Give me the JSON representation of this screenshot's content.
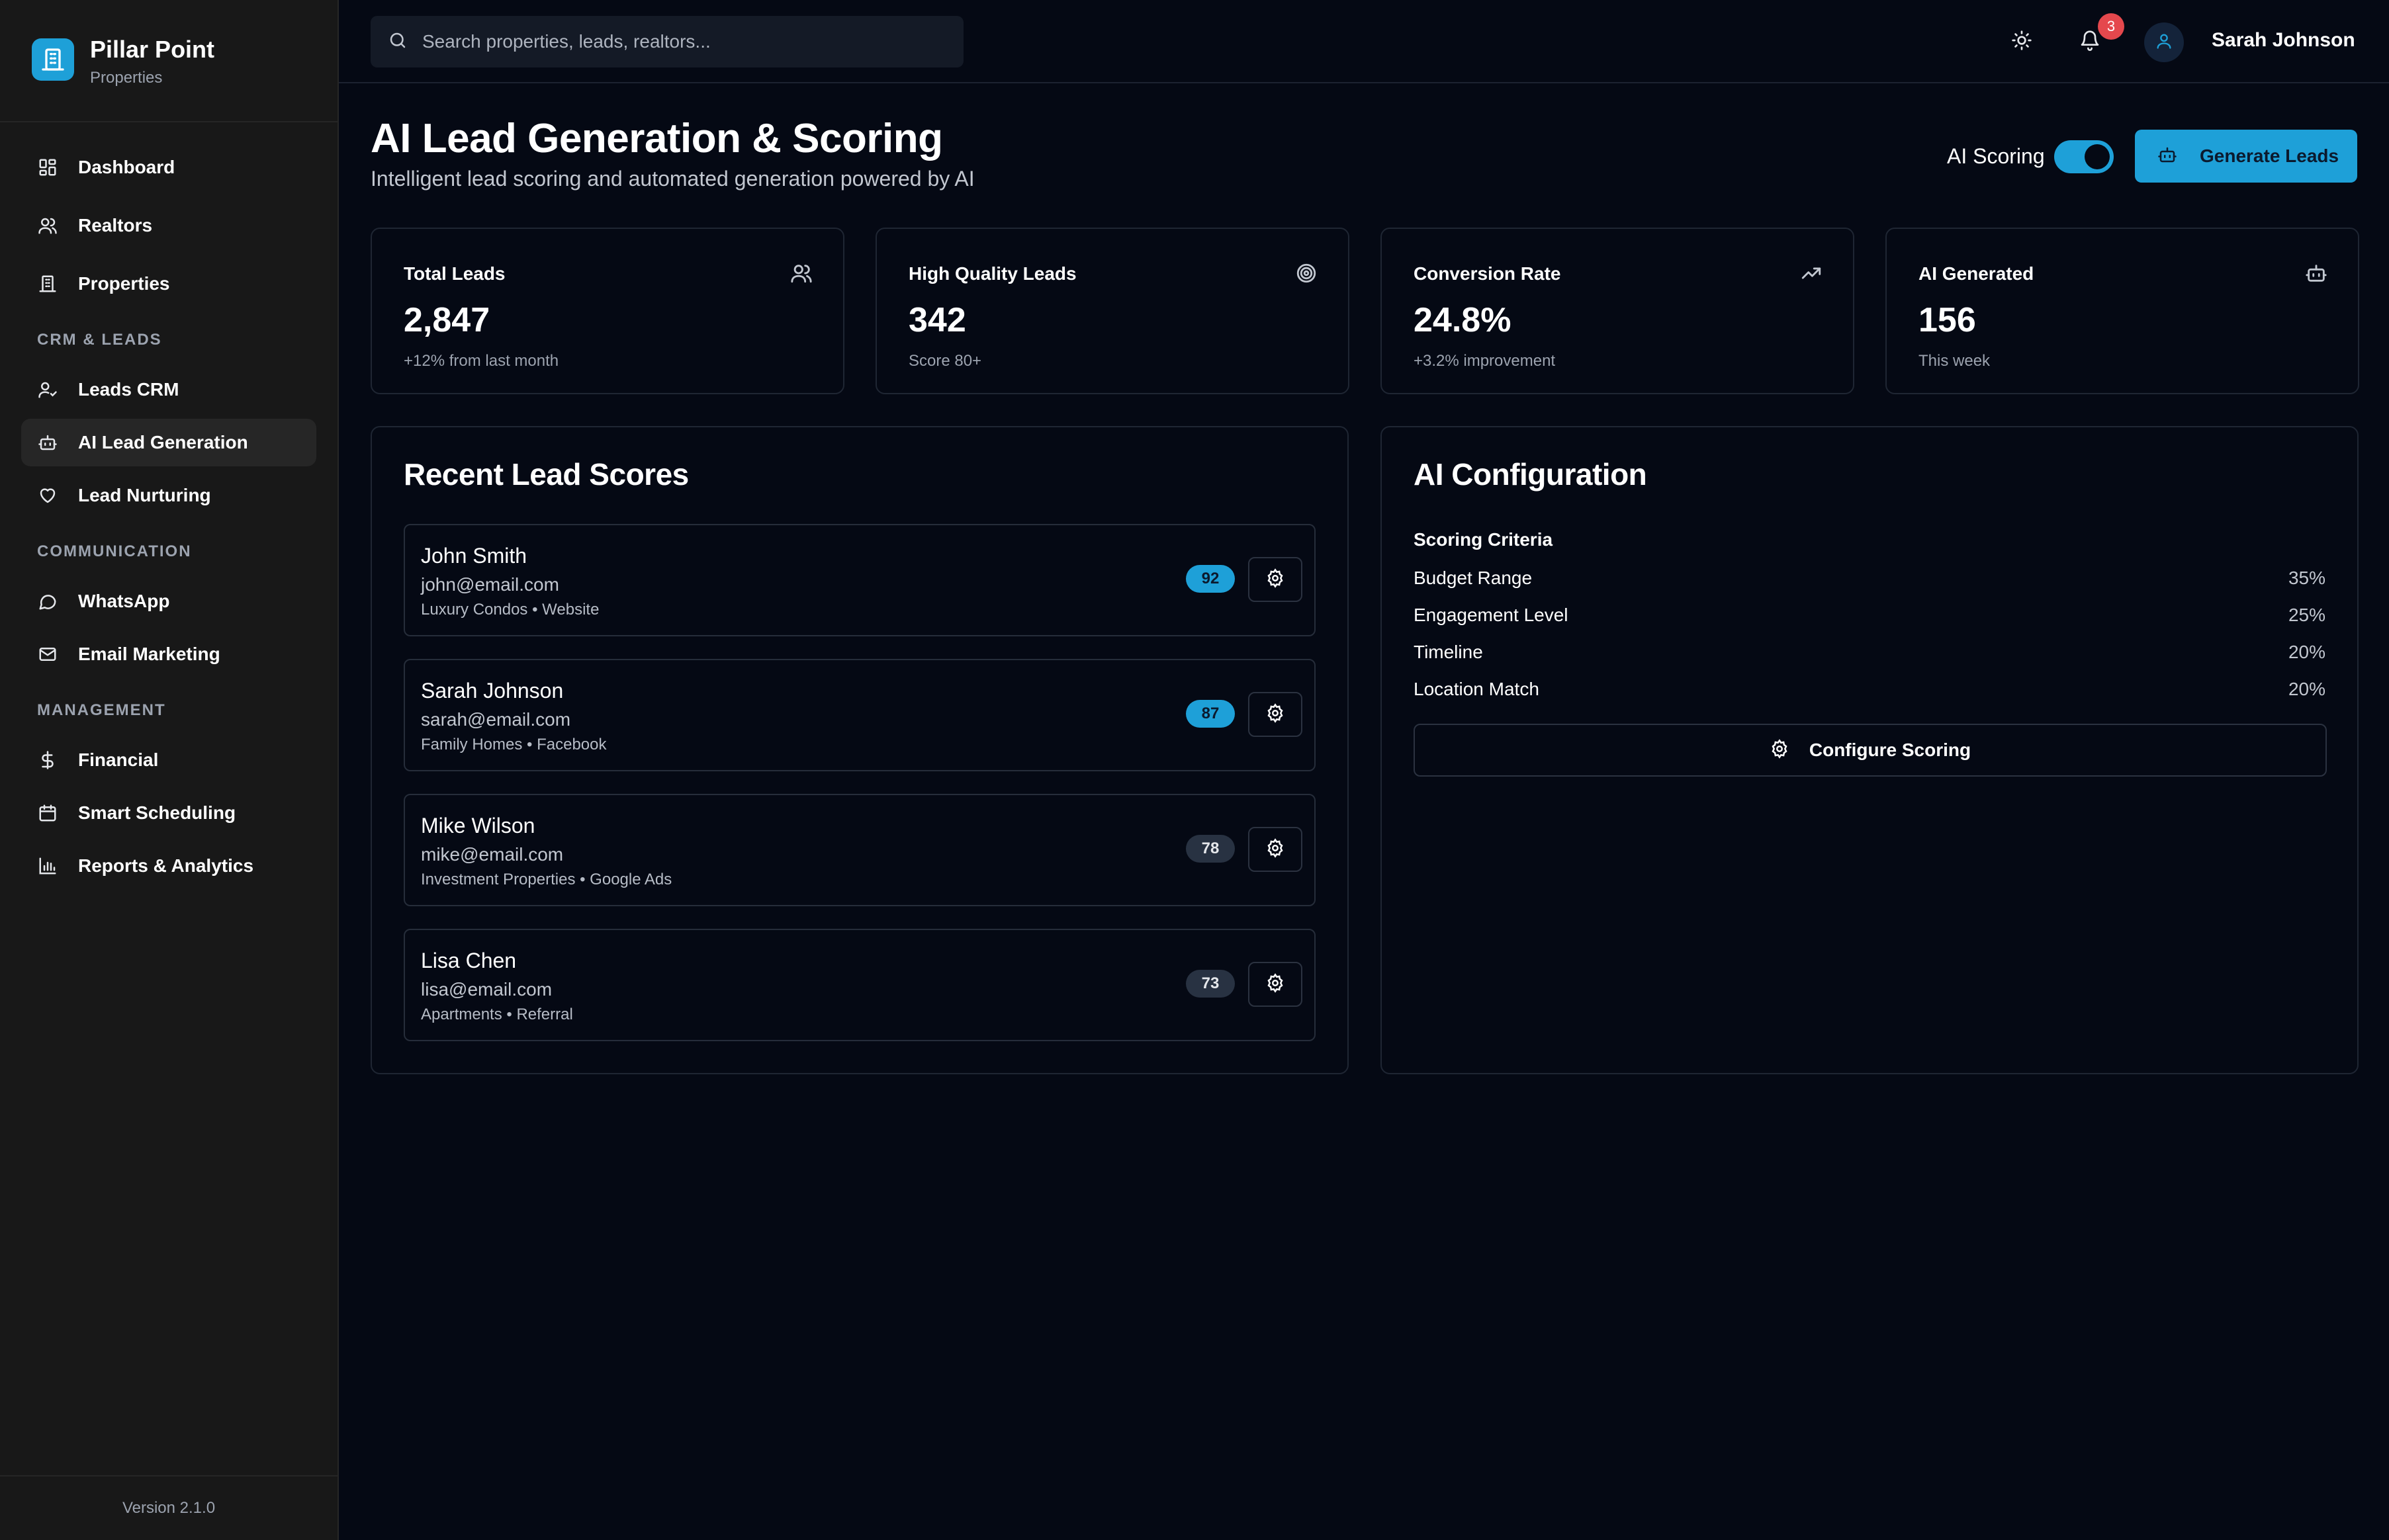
{
  "brand": {
    "name": "Pillar Point",
    "subtitle": "Properties"
  },
  "sidebar": {
    "items_top": [
      {
        "label": "Dashboard",
        "icon": "dashboard-icon"
      },
      {
        "label": "Realtors",
        "icon": "users-icon"
      },
      {
        "label": "Properties",
        "icon": "building-icon"
      }
    ],
    "section_crm": "CRM & LEADS",
    "items_crm": [
      {
        "label": "Leads CRM",
        "icon": "user-check-icon"
      },
      {
        "label": "AI Lead Generation",
        "icon": "bot-icon",
        "active": true
      },
      {
        "label": "Lead Nurturing",
        "icon": "heart-icon"
      }
    ],
    "section_comm": "COMMUNICATION",
    "items_comm": [
      {
        "label": "WhatsApp",
        "icon": "message-circle-icon"
      },
      {
        "label": "Email Marketing",
        "icon": "mail-icon"
      }
    ],
    "section_mgmt": "MANAGEMENT",
    "items_mgmt": [
      {
        "label": "Financial",
        "icon": "dollar-icon"
      },
      {
        "label": "Smart Scheduling",
        "icon": "calendar-icon"
      },
      {
        "label": "Reports & Analytics",
        "icon": "bar-chart-icon"
      }
    ],
    "version": "Version 2.1.0"
  },
  "topbar": {
    "search_placeholder": "Search properties, leads, realtors...",
    "notification_count": "3",
    "user_name": "Sarah Johnson"
  },
  "header": {
    "title": "AI Lead Generation & Scoring",
    "subtitle": "Intelligent lead scoring and automated generation powered by AI",
    "toggle_label": "AI Scoring",
    "toggle_on": true,
    "generate_button": "Generate Leads"
  },
  "stats": [
    {
      "title": "Total Leads",
      "value": "2,847",
      "note": "+12% from last month",
      "icon": "users-icon"
    },
    {
      "title": "High Quality Leads",
      "value": "342",
      "note": "Score 80+",
      "icon": "target-icon"
    },
    {
      "title": "Conversion Rate",
      "value": "24.8%",
      "note": "+3.2% improvement",
      "icon": "trending-up-icon"
    },
    {
      "title": "AI Generated",
      "value": "156",
      "note": "This week",
      "icon": "bot-icon"
    }
  ],
  "recent": {
    "title": "Recent Lead Scores",
    "leads": [
      {
        "name": "John Smith",
        "email": "john@email.com",
        "meta": "Luxury Condos • Website",
        "score": "92",
        "high": true
      },
      {
        "name": "Sarah Johnson",
        "email": "sarah@email.com",
        "meta": "Family Homes • Facebook",
        "score": "87",
        "high": true
      },
      {
        "name": "Mike Wilson",
        "email": "mike@email.com",
        "meta": "Investment Properties • Google Ads",
        "score": "78",
        "high": false
      },
      {
        "name": "Lisa Chen",
        "email": "lisa@email.com",
        "meta": "Apartments • Referral",
        "score": "73",
        "high": false
      }
    ]
  },
  "config": {
    "title": "AI Configuration",
    "criteria_heading": "Scoring Criteria",
    "criteria": [
      {
        "label": "Budget Range",
        "value": "35%"
      },
      {
        "label": "Engagement Level",
        "value": "25%"
      },
      {
        "label": "Timeline",
        "value": "20%"
      },
      {
        "label": "Location Match",
        "value": "20%"
      }
    ],
    "button": "Configure Scoring"
  },
  "colors": {
    "accent": "#1ea0d8",
    "background": "#050914",
    "sidebar": "#181818",
    "badge": "#e5484d"
  }
}
